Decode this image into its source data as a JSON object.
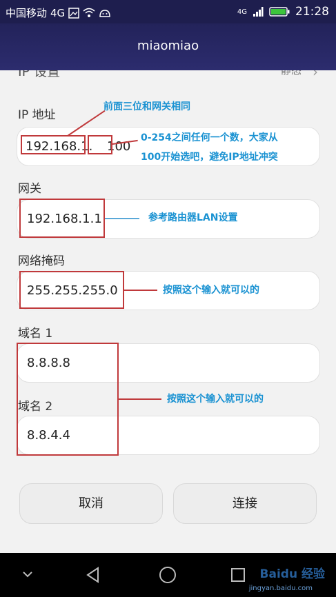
{
  "status_bar": {
    "carrier": "中国移动",
    "network": "4G",
    "signal_network": "4G",
    "time": "21:28"
  },
  "header": {
    "title": "miaomiao"
  },
  "ip_settings": {
    "label": "IP 设置",
    "value": "静态"
  },
  "form": {
    "ip_address": {
      "label": "IP 地址",
      "prefix": "192.168.1.",
      "suffix": "100"
    },
    "gateway": {
      "label": "网关",
      "value": "192.168.1.1"
    },
    "netmask": {
      "label": "网络掩码",
      "value": "255.255.255.0"
    },
    "dns1": {
      "label": "域名 1",
      "value": "8.8.8.8"
    },
    "dns2": {
      "label": "域名 2",
      "value": "8.8.4.4"
    }
  },
  "annotations": {
    "ip_prefix_note": "前面三位和网关相同",
    "ip_suffix_note_line1": "0-254之间任何一个数，大家从",
    "ip_suffix_note_line2": "100开始选吧，避免IP地址冲突",
    "gateway_note": "参考路由器LAN设置",
    "netmask_note": "按照这个输入就可以的",
    "dns_note": "按照这个输入就可以的"
  },
  "buttons": {
    "cancel": "取消",
    "connect": "连接"
  },
  "watermark": {
    "text": "Baidu 经验",
    "sub": "jingyan.baidu.com"
  },
  "colors": {
    "title_bar": "#2c2c6e",
    "annotation_text": "#1a92d2",
    "highlight_box": "#c0393b"
  }
}
